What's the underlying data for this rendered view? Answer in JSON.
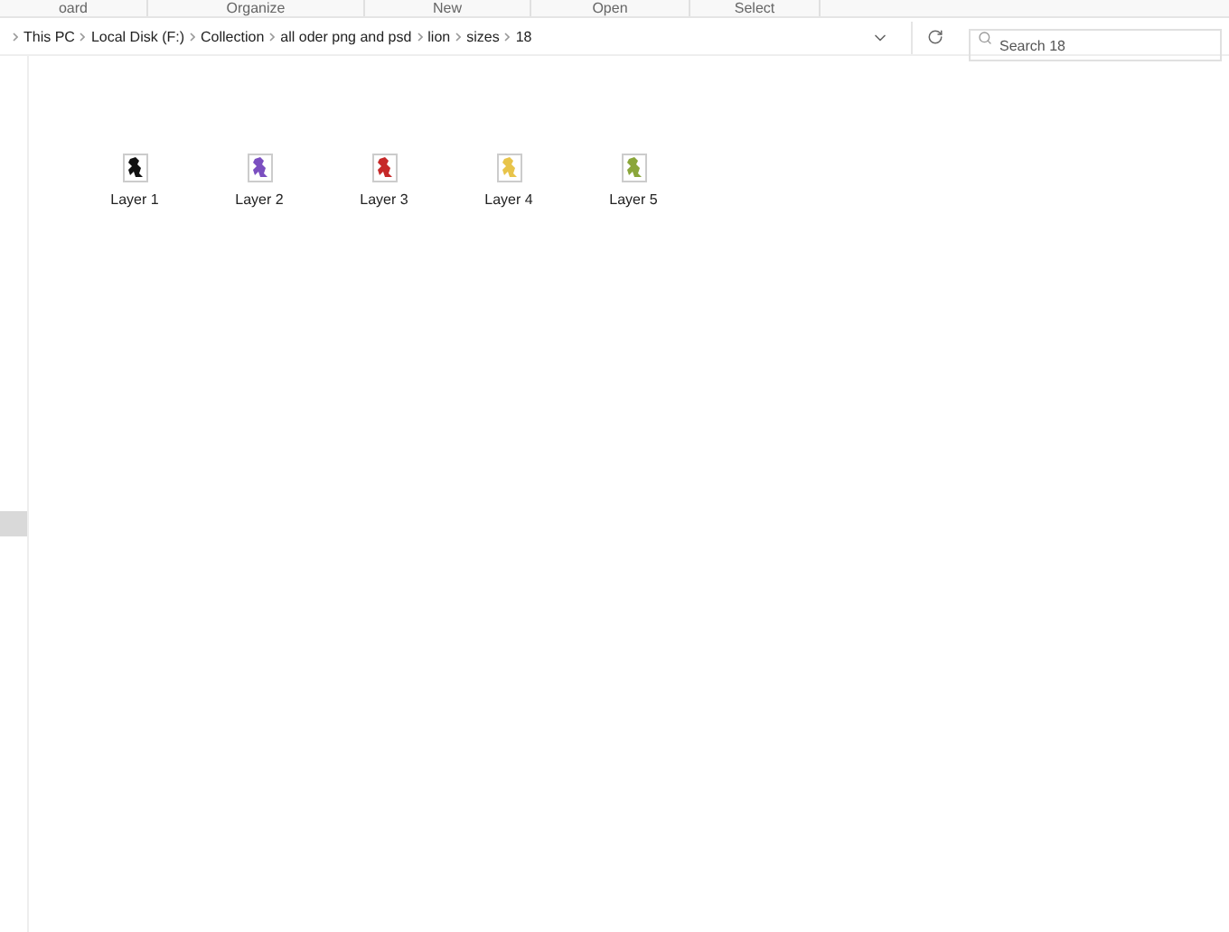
{
  "ribbon_groups": [
    "oard",
    "Organize",
    "New",
    "Open",
    "Select"
  ],
  "breadcrumb": [
    "This PC",
    "Local Disk (F:)",
    "Collection",
    "all oder png and psd",
    "lion",
    "sizes",
    "18"
  ],
  "search": {
    "placeholder": "Search 18"
  },
  "files": [
    {
      "name": "Layer 1",
      "color": "#111111"
    },
    {
      "name": "Layer 2",
      "color": "#7b4fc0"
    },
    {
      "name": "Layer 3",
      "color": "#c62828"
    },
    {
      "name": "Layer 4",
      "color": "#e8c44a"
    },
    {
      "name": "Layer 5",
      "color": "#8aa63a"
    }
  ]
}
